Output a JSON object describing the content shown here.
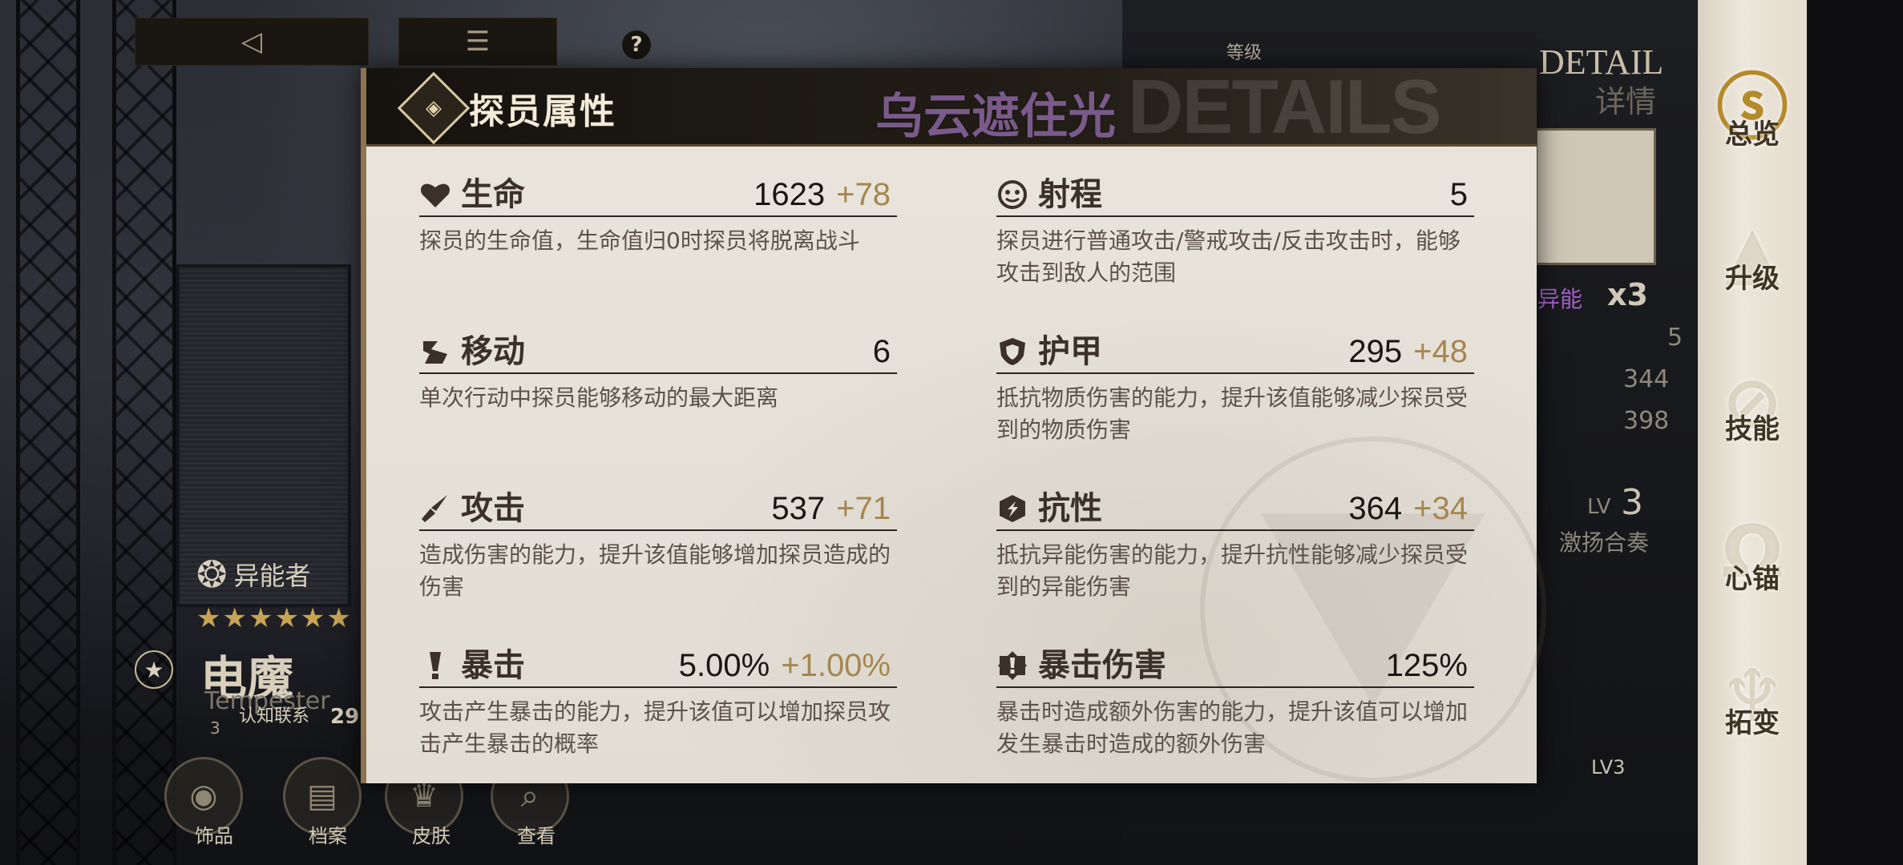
{
  "top_controls": {
    "back_icon": "back-triangle-icon",
    "home_icon": "home-icon",
    "help_label": "?"
  },
  "character": {
    "class_label": "异能者",
    "stars": "★★★★★★",
    "name": "电魔",
    "name_en": "Tempester",
    "bond_label": "认知联系",
    "bond_value": "29",
    "bond_level": "3"
  },
  "bottom_nav": [
    {
      "label": "饰品"
    },
    {
      "label": "档案"
    },
    {
      "label": "皮肤"
    },
    {
      "label": "查看"
    }
  ],
  "right_panel": {
    "level_label": "等级",
    "detail_label": "DETAIL",
    "detail_cn": "详情",
    "talent_label": "异能",
    "talent_count": "x3",
    "val1": "5",
    "val2": "344",
    "val3": "398",
    "lv_label": "LV",
    "lv_value": "3",
    "skill_name": "激扬合奏",
    "bottom_lv": "LV3"
  },
  "side_menu": [
    {
      "label": "总览",
      "active": true
    },
    {
      "label": "升级",
      "active": false
    },
    {
      "label": "技能",
      "active": false
    },
    {
      "label": "心锚",
      "active": false
    },
    {
      "label": "拓变",
      "active": false
    }
  ],
  "modal": {
    "title": "探员属性",
    "watermark": "DETAILS",
    "overlay_text": "乌云遮住光",
    "stats": [
      {
        "name": "生命",
        "icon": "heart-icon",
        "base": "1623",
        "bonus": "+78",
        "desc": "探员的生命值，生命值归0时探员将脱离战斗"
      },
      {
        "name": "射程",
        "icon": "target-icon",
        "base": "5",
        "bonus": "",
        "desc": "探员进行普通攻击/警戒攻击/反击攻击时，能够攻击到敌人的范围"
      },
      {
        "name": "移动",
        "icon": "boot-icon",
        "base": "6",
        "bonus": "",
        "desc": "单次行动中探员能够移动的最大距离"
      },
      {
        "name": "护甲",
        "icon": "shield-icon",
        "base": "295",
        "bonus": "+48",
        "desc": "抵抗物质伤害的能力，提升该值能够减少探员受到的物质伤害"
      },
      {
        "name": "攻击",
        "icon": "sword-icon",
        "base": "537",
        "bonus": "+71",
        "desc": "造成伤害的能力，提升该值能够增加探员造成的伤害"
      },
      {
        "name": "抗性",
        "icon": "resist-shield-icon",
        "base": "364",
        "bonus": "+34",
        "desc": "抵抗异能伤害的能力，提升抗性能够减少探员受到的异能伤害"
      },
      {
        "name": "暴击",
        "icon": "exclamation-icon",
        "base": "5.00%",
        "bonus": "+1.00%",
        "desc": "攻击产生暴击的能力，提升该值可以增加探员攻击产生暴击的概率"
      },
      {
        "name": "暴击伤害",
        "icon": "crit-damage-icon",
        "base": "125%",
        "bonus": "",
        "desc": "暴击时造成额外伤害的能力，提升该值可以增加发生暴击时造成的额外伤害"
      }
    ]
  },
  "colors": {
    "modal_bg": "#e5e1d8",
    "header_bg": "#1c1813",
    "bonus": "#a6864f",
    "title_text": "#f3ead8",
    "overlay": "#7a5a8a",
    "side_menu_bg": "#e6dfd2"
  }
}
